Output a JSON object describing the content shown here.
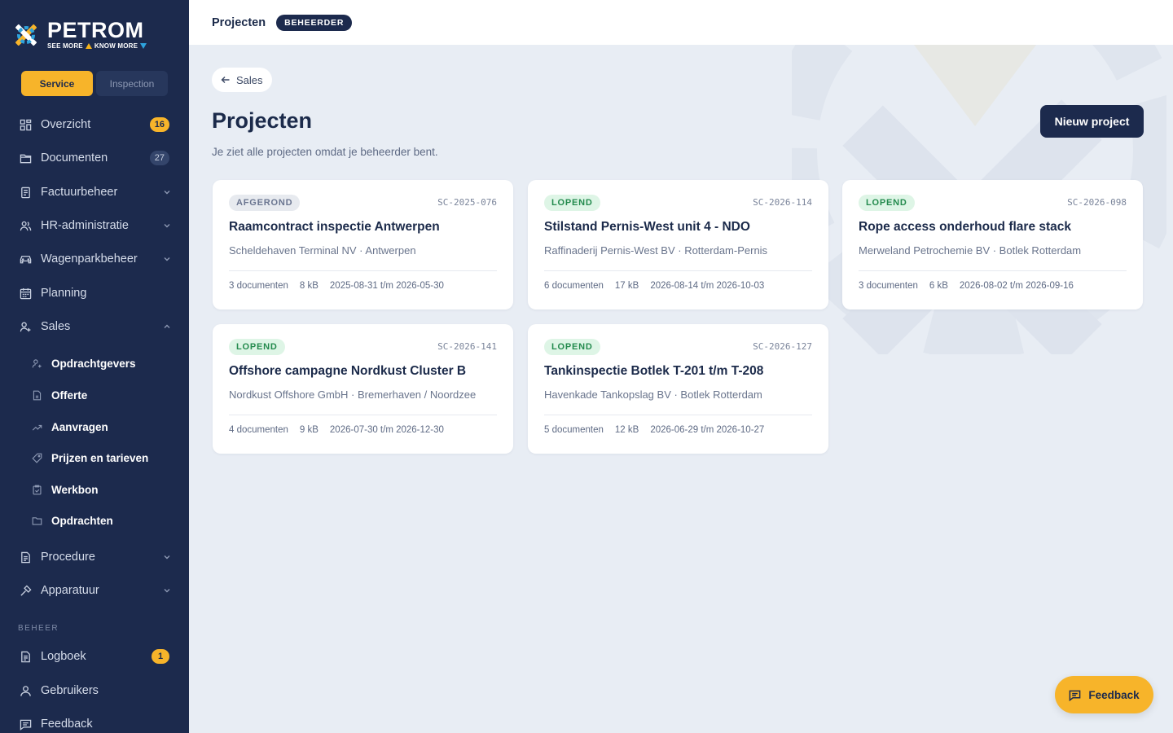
{
  "brand": {
    "name": "PETROM",
    "tagline_left": "SEE MORE",
    "tagline_right": "KNOW MORE",
    "colors": {
      "yellow": "#f7b42a",
      "navy": "#1c2a4d",
      "blue": "#2ea3dd"
    }
  },
  "mode_switch": {
    "active": "Service",
    "inactive": "Inspection"
  },
  "nav": {
    "overzicht": {
      "label": "Overzicht",
      "icon": "grid-icon",
      "badge": "16"
    },
    "documenten": {
      "label": "Documenten",
      "icon": "folder-icon",
      "badge": "27"
    },
    "factuurbeheer": {
      "label": "Factuurbeheer",
      "icon": "invoice-icon"
    },
    "hr": {
      "label": "HR-administratie",
      "icon": "users-icon"
    },
    "wagenpark": {
      "label": "Wagenparkbeheer",
      "icon": "car-icon"
    },
    "planning": {
      "label": "Planning",
      "icon": "calendar-icon"
    },
    "sales": {
      "label": "Sales",
      "icon": "user-plus-icon"
    },
    "sales_sub": [
      {
        "label": "Opdrachtgevers",
        "icon": "user-plus-icon"
      },
      {
        "label": "Offerte",
        "icon": "file-icon"
      },
      {
        "label": "Aanvragen",
        "icon": "trend-icon"
      },
      {
        "label": "Prijzen en tarieven",
        "icon": "tag-icon"
      },
      {
        "label": "Werkbon",
        "icon": "clipboard-icon"
      },
      {
        "label": "Opdrachten",
        "icon": "folder-icon"
      }
    ],
    "procedure": {
      "label": "Procedure",
      "icon": "document-icon"
    },
    "apparatuur": {
      "label": "Apparatuur",
      "icon": "hammer-icon"
    },
    "section_beheer": "BEHEER",
    "logboek": {
      "label": "Logboek",
      "icon": "log-icon",
      "badge": "1"
    },
    "gebruikers": {
      "label": "Gebruikers",
      "icon": "user-icon"
    },
    "feedback": {
      "label": "Feedback",
      "icon": "message-icon"
    }
  },
  "topbar": {
    "title": "Projecten",
    "role": "BEHEERDER"
  },
  "page": {
    "back_label": "Sales",
    "title": "Projecten",
    "subtitle": "Je ziet alle projecten omdat je beheerder bent.",
    "new_button": "Nieuw project"
  },
  "projects": [
    {
      "status": "AFGEROND",
      "code": "SC-2025-076",
      "title": "Raamcontract inspectie Antwerpen",
      "client": "Scheldehaven Terminal NV · Antwerpen",
      "docs": "3 documenten",
      "size": "8 kB",
      "period": "2025-08-31 t/m 2026-05-30"
    },
    {
      "status": "LOPEND",
      "code": "SC-2026-114",
      "title": "Stilstand Pernis-West unit 4 - NDO",
      "client": "Raffinaderij Pernis-West BV · Rotterdam-Pernis",
      "docs": "6 documenten",
      "size": "17 kB",
      "period": "2026-08-14 t/m 2026-10-03"
    },
    {
      "status": "LOPEND",
      "code": "SC-2026-098",
      "title": "Rope access onderhoud flare stack",
      "client": "Merweland Petrochemie BV · Botlek Rotterdam",
      "docs": "3 documenten",
      "size": "6 kB",
      "period": "2026-08-02 t/m 2026-09-16"
    },
    {
      "status": "LOPEND",
      "code": "SC-2026-141",
      "title": "Offshore campagne Nordkust Cluster B",
      "client": "Nordkust Offshore GmbH · Bremerhaven / Noordzee",
      "docs": "4 documenten",
      "size": "9 kB",
      "period": "2026-07-30 t/m 2026-12-30"
    },
    {
      "status": "LOPEND",
      "code": "SC-2026-127",
      "title": "Tankinspectie Botlek T-201 t/m T-208",
      "client": "Havenkade Tankopslag BV · Botlek Rotterdam",
      "docs": "5 documenten",
      "size": "12 kB",
      "period": "2026-06-29 t/m 2026-10-27"
    }
  ],
  "feedback_fab": {
    "label": "Feedback",
    "icon": "message-icon"
  }
}
